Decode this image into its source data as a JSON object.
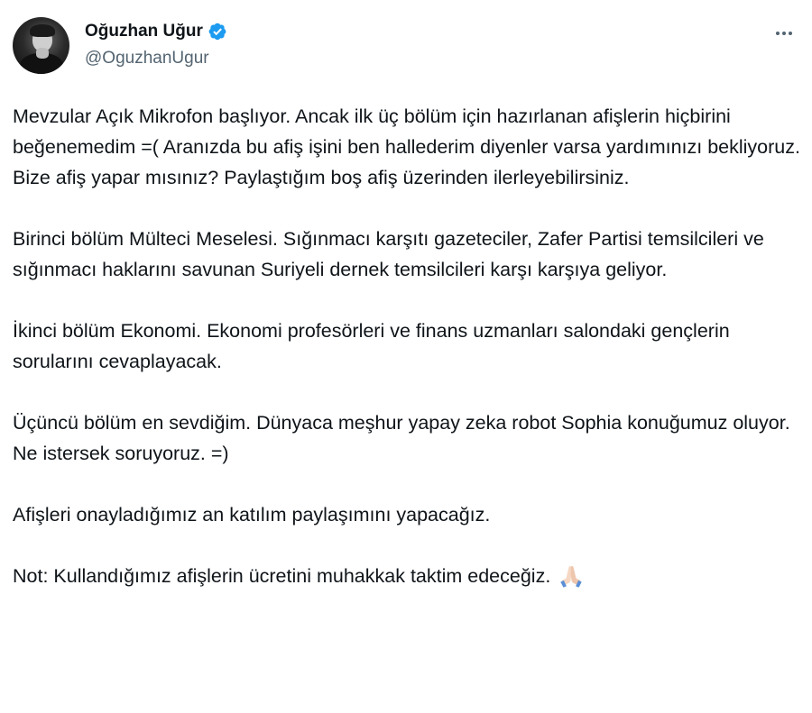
{
  "author": {
    "display_name": "Oğuzhan Uğur",
    "handle": "@OguzhanUgur",
    "verified": true,
    "avatar_icon": "avatar-photo"
  },
  "menu_icon": "more-horizontal-icon",
  "colors": {
    "verified_blue": "#1d9bf0",
    "text_primary": "#0f1419",
    "text_secondary": "#536471"
  },
  "paragraphs": [
    "Mevzular Açık Mikrofon başlıyor. Ancak ilk üç bölüm için hazırlanan afişlerin hiçbirini beğenemedim =( Aranızda bu afiş işini ben hallederim diyenler varsa yardımınızı bekliyoruz. Bize afiş yapar mısınız? Paylaştığım boş afiş üzerinden ilerleyebilirsiniz.",
    "Birinci bölüm Mülteci Meselesi. Sığınmacı karşıtı gazeteciler, Zafer Partisi temsilcileri ve sığınmacı haklarını savunan Suriyeli dernek temsilcileri karşı karşıya geliyor.",
    "İkinci bölüm Ekonomi. Ekonomi profesörleri ve finans uzmanları salondaki gençlerin sorularını cevaplayacak.",
    "Üçüncü bölüm en sevdiğim. Dünyaca meşhur yapay zeka robot Sophia konuğumuz oluyor. Ne istersek soruyoruz.  =)",
    "Afişleri onayladığımız an katılım paylaşımını yapacağız.",
    "Not: Kullandığımız afişlerin ücretini muhakkak taktim edeceğiz."
  ],
  "trailing_emoji": "folded-hands-emoji"
}
